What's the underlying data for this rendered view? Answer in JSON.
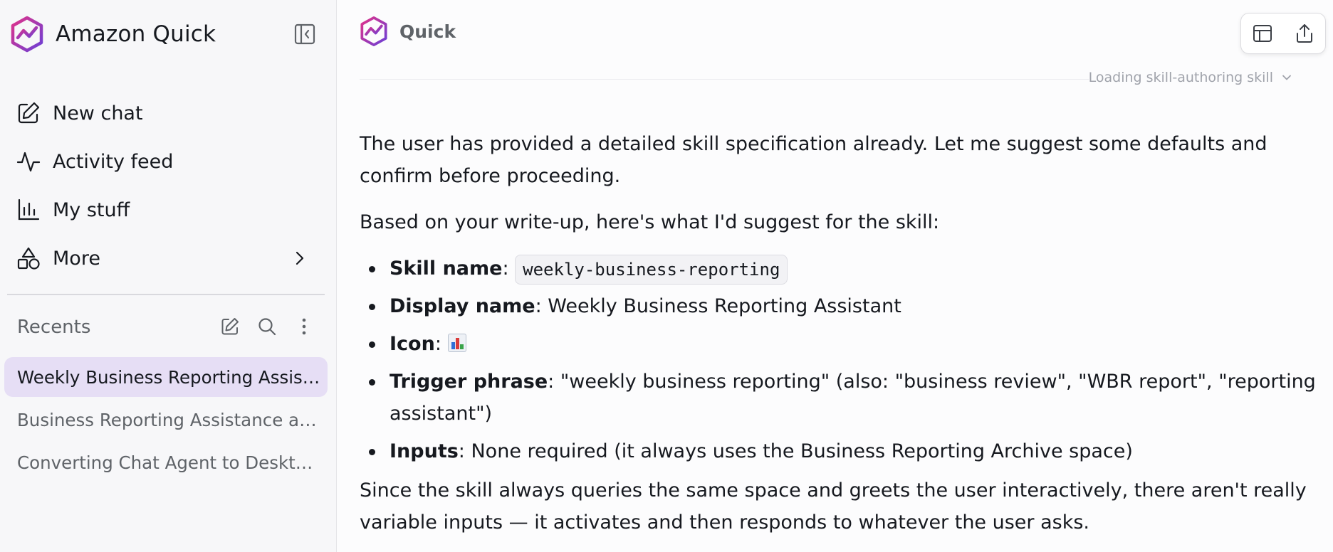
{
  "sidebar": {
    "brand_name": "Amazon Quick",
    "nav": [
      {
        "label": "New chat",
        "icon": "edit-icon"
      },
      {
        "label": "Activity feed",
        "icon": "activity-icon"
      },
      {
        "label": "My stuff",
        "icon": "bar-chart-icon"
      },
      {
        "label": "More",
        "icon": "shapes-icon"
      }
    ],
    "recents_label": "Recents",
    "recents": [
      "Weekly Business Reporting Assistant",
      "Business Reporting Assistance and Analysis",
      "Converting Chat Agent to Desktop App"
    ]
  },
  "main": {
    "title": "Quick",
    "loading_status": "Loading skill-authoring skill",
    "intro": "The user has provided a detailed skill specification already. Let me suggest some defaults and confirm before proceeding.",
    "lead": "Based on your write-up, here's what I'd suggest for the skill:",
    "items": [
      {
        "label": "Skill name",
        "sep": ": ",
        "value": "weekly-business-reporting"
      },
      {
        "label": "Display name",
        "sep": ": ",
        "value": "Weekly Business Reporting Assistant"
      },
      {
        "label": "Icon",
        "sep": ": ",
        "value": "bar-chart-emoji"
      },
      {
        "label": "Trigger phrase",
        "sep": ": ",
        "value": "\"weekly business reporting\" (also: \"business review\", \"WBR report\", \"reporting assistant\")"
      },
      {
        "label": "Inputs",
        "sep": ": ",
        "value": "None required (it always uses the Business Reporting Archive space)"
      }
    ],
    "closing": "Since the skill always queries the same space and greets the user interactively, there aren't really variable inputs — it activates and then responds to whatever the user asks."
  },
  "colors": {
    "accent": "#8c4fd8",
    "active_recent_bg": "#e6def5",
    "sidebar_bg": "#f7f7f9"
  }
}
